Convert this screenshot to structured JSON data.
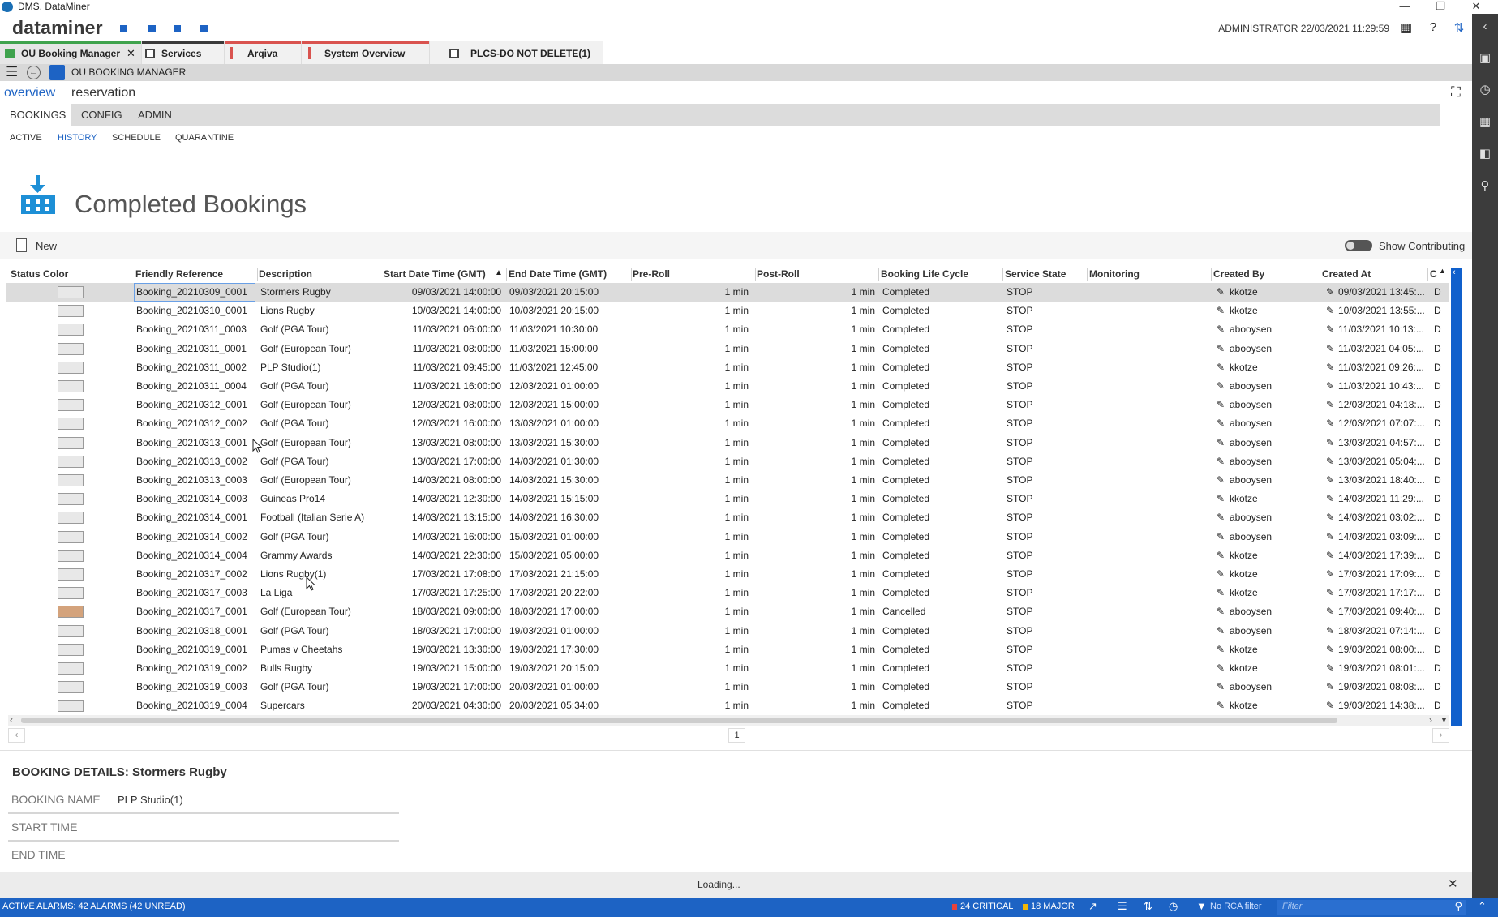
{
  "window": {
    "title": "DMS, DataMiner"
  },
  "header": {
    "brand": "dataminer",
    "user": "ADMINISTRATOR",
    "datetime": "22/03/2021 11:29:59"
  },
  "tabs": [
    {
      "label": "OU Booking Manager",
      "stripe": "#3fa34d",
      "active": true
    },
    {
      "label": "Services",
      "stripe": "#3a3a3a"
    },
    {
      "label": "Arqiva",
      "stripe": "#d9534f"
    },
    {
      "label": "System Overview",
      "stripe": "#d9534f"
    },
    {
      "label": "PLCS-DO NOT DELETE(1)",
      "stripe": ""
    }
  ],
  "pagebar": {
    "title": "OU BOOKING MANAGER"
  },
  "nav_primary": [
    "overview",
    "reservation"
  ],
  "nav_secondary": [
    "BOOKINGS",
    "CONFIG",
    "ADMIN"
  ],
  "nav_tertiary": [
    "ACTIVE",
    "HISTORY",
    "SCHEDULE",
    "QUARANTINE"
  ],
  "page": {
    "title": "Completed Bookings"
  },
  "actions": {
    "new_label": "New",
    "toggle_label": "Show Contributing"
  },
  "table": {
    "columns": [
      "Status Color",
      "Friendly Reference",
      "Description",
      "Start Date Time (GMT)",
      "End Date Time (GMT)",
      "Pre-Roll",
      "Post-Roll",
      "Booking Life Cycle",
      "Service State",
      "Monitoring",
      "Created By",
      "Created At",
      "C"
    ],
    "rows": [
      {
        "color": "#e8e8e8",
        "ref": "Booking_20210309_0001",
        "desc": "Stormers Rugby",
        "start": "09/03/2021 14:00:00",
        "end": "09/03/2021 20:15:00",
        "pre": "1 min",
        "post": "1 min",
        "life": "Completed",
        "state": "STOP",
        "by": "kkotze",
        "at": "09/03/2021 13:45:...",
        "c": "D"
      },
      {
        "color": "#e8e8e8",
        "ref": "Booking_20210310_0001",
        "desc": "Lions Rugby",
        "start": "10/03/2021 14:00:00",
        "end": "10/03/2021 20:15:00",
        "pre": "1 min",
        "post": "1 min",
        "life": "Completed",
        "state": "STOP",
        "by": "kkotze",
        "at": "10/03/2021 13:55:...",
        "c": "D"
      },
      {
        "color": "#e8e8e8",
        "ref": "Booking_20210311_0003",
        "desc": "Golf (PGA Tour)",
        "start": "11/03/2021 06:00:00",
        "end": "11/03/2021 10:30:00",
        "pre": "1 min",
        "post": "1 min",
        "life": "Completed",
        "state": "STOP",
        "by": "abooysen",
        "at": "11/03/2021 10:13:...",
        "c": "D"
      },
      {
        "color": "#e8e8e8",
        "ref": "Booking_20210311_0001",
        "desc": "Golf (European Tour)",
        "start": "11/03/2021 08:00:00",
        "end": "11/03/2021 15:00:00",
        "pre": "1 min",
        "post": "1 min",
        "life": "Completed",
        "state": "STOP",
        "by": "abooysen",
        "at": "11/03/2021 04:05:...",
        "c": "D"
      },
      {
        "color": "#e8e8e8",
        "ref": "Booking_20210311_0002",
        "desc": "PLP Studio(1)",
        "start": "11/03/2021 09:45:00",
        "end": "11/03/2021 12:45:00",
        "pre": "1 min",
        "post": "1 min",
        "life": "Completed",
        "state": "STOP",
        "by": "kkotze",
        "at": "11/03/2021 09:26:...",
        "c": "D"
      },
      {
        "color": "#e8e8e8",
        "ref": "Booking_20210311_0004",
        "desc": "Golf (PGA Tour)",
        "start": "11/03/2021 16:00:00",
        "end": "12/03/2021 01:00:00",
        "pre": "1 min",
        "post": "1 min",
        "life": "Completed",
        "state": "STOP",
        "by": "abooysen",
        "at": "11/03/2021 10:43:...",
        "c": "D"
      },
      {
        "color": "#e8e8e8",
        "ref": "Booking_20210312_0001",
        "desc": "Golf (European Tour)",
        "start": "12/03/2021 08:00:00",
        "end": "12/03/2021 15:00:00",
        "pre": "1 min",
        "post": "1 min",
        "life": "Completed",
        "state": "STOP",
        "by": "abooysen",
        "at": "12/03/2021 04:18:...",
        "c": "D"
      },
      {
        "color": "#e8e8e8",
        "ref": "Booking_20210312_0002",
        "desc": "Golf (PGA Tour)",
        "start": "12/03/2021 16:00:00",
        "end": "13/03/2021 01:00:00",
        "pre": "1 min",
        "post": "1 min",
        "life": "Completed",
        "state": "STOP",
        "by": "abooysen",
        "at": "12/03/2021 07:07:...",
        "c": "D"
      },
      {
        "color": "#e8e8e8",
        "ref": "Booking_20210313_0001",
        "desc": "Golf (European Tour)",
        "start": "13/03/2021 08:00:00",
        "end": "13/03/2021 15:30:00",
        "pre": "1 min",
        "post": "1 min",
        "life": "Completed",
        "state": "STOP",
        "by": "abooysen",
        "at": "13/03/2021 04:57:...",
        "c": "D"
      },
      {
        "color": "#e8e8e8",
        "ref": "Booking_20210313_0002",
        "desc": "Golf (PGA Tour)",
        "start": "13/03/2021 17:00:00",
        "end": "14/03/2021 01:30:00",
        "pre": "1 min",
        "post": "1 min",
        "life": "Completed",
        "state": "STOP",
        "by": "abooysen",
        "at": "13/03/2021 05:04:...",
        "c": "D"
      },
      {
        "color": "#e8e8e8",
        "ref": "Booking_20210313_0003",
        "desc": "Golf (European Tour)",
        "start": "14/03/2021 08:00:00",
        "end": "14/03/2021 15:30:00",
        "pre": "1 min",
        "post": "1 min",
        "life": "Completed",
        "state": "STOP",
        "by": "abooysen",
        "at": "13/03/2021 18:40:...",
        "c": "D"
      },
      {
        "color": "#e8e8e8",
        "ref": "Booking_20210314_0003",
        "desc": "Guineas Pro14",
        "start": "14/03/2021 12:30:00",
        "end": "14/03/2021 15:15:00",
        "pre": "1 min",
        "post": "1 min",
        "life": "Completed",
        "state": "STOP",
        "by": "kkotze",
        "at": "14/03/2021 11:29:...",
        "c": "D"
      },
      {
        "color": "#e8e8e8",
        "ref": "Booking_20210314_0001",
        "desc": "Football (Italian Serie A)",
        "start": "14/03/2021 13:15:00",
        "end": "14/03/2021 16:30:00",
        "pre": "1 min",
        "post": "1 min",
        "life": "Completed",
        "state": "STOP",
        "by": "abooysen",
        "at": "14/03/2021 03:02:...",
        "c": "D"
      },
      {
        "color": "#e8e8e8",
        "ref": "Booking_20210314_0002",
        "desc": "Golf (PGA Tour)",
        "start": "14/03/2021 16:00:00",
        "end": "15/03/2021 01:00:00",
        "pre": "1 min",
        "post": "1 min",
        "life": "Completed",
        "state": "STOP",
        "by": "abooysen",
        "at": "14/03/2021 03:09:...",
        "c": "D"
      },
      {
        "color": "#e8e8e8",
        "ref": "Booking_20210314_0004",
        "desc": "Grammy Awards",
        "start": "14/03/2021 22:30:00",
        "end": "15/03/2021 05:00:00",
        "pre": "1 min",
        "post": "1 min",
        "life": "Completed",
        "state": "STOP",
        "by": "kkotze",
        "at": "14/03/2021 17:39:...",
        "c": "D"
      },
      {
        "color": "#e8e8e8",
        "ref": "Booking_20210317_0002",
        "desc": "Lions Rugby(1)",
        "start": "17/03/2021 17:08:00",
        "end": "17/03/2021 21:15:00",
        "pre": "1 min",
        "post": "1 min",
        "life": "Completed",
        "state": "STOP",
        "by": "kkotze",
        "at": "17/03/2021 17:09:...",
        "c": "D"
      },
      {
        "color": "#e8e8e8",
        "ref": "Booking_20210317_0003",
        "desc": "La Liga",
        "start": "17/03/2021 17:25:00",
        "end": "17/03/2021 20:22:00",
        "pre": "1 min",
        "post": "1 min",
        "life": "Completed",
        "state": "STOP",
        "by": "kkotze",
        "at": "17/03/2021 17:17:...",
        "c": "D"
      },
      {
        "color": "#d4a37c",
        "ref": "Booking_20210317_0001",
        "desc": "Golf (European Tour)",
        "start": "18/03/2021 09:00:00",
        "end": "18/03/2021 17:00:00",
        "pre": "1 min",
        "post": "1 min",
        "life": "Cancelled",
        "state": "STOP",
        "by": "abooysen",
        "at": "17/03/2021 09:40:...",
        "c": "D"
      },
      {
        "color": "#e8e8e8",
        "ref": "Booking_20210318_0001",
        "desc": "Golf (PGA Tour)",
        "start": "18/03/2021 17:00:00",
        "end": "19/03/2021 01:00:00",
        "pre": "1 min",
        "post": "1 min",
        "life": "Completed",
        "state": "STOP",
        "by": "abooysen",
        "at": "18/03/2021 07:14:...",
        "c": "D"
      },
      {
        "color": "#e8e8e8",
        "ref": "Booking_20210319_0001",
        "desc": "Pumas v Cheetahs",
        "start": "19/03/2021 13:30:00",
        "end": "19/03/2021 17:30:00",
        "pre": "1 min",
        "post": "1 min",
        "life": "Completed",
        "state": "STOP",
        "by": "kkotze",
        "at": "19/03/2021 08:00:...",
        "c": "D"
      },
      {
        "color": "#e8e8e8",
        "ref": "Booking_20210319_0002",
        "desc": "Bulls Rugby",
        "start": "19/03/2021 15:00:00",
        "end": "19/03/2021 20:15:00",
        "pre": "1 min",
        "post": "1 min",
        "life": "Completed",
        "state": "STOP",
        "by": "kkotze",
        "at": "19/03/2021 08:01:...",
        "c": "D"
      },
      {
        "color": "#e8e8e8",
        "ref": "Booking_20210319_0003",
        "desc": "Golf (PGA Tour)",
        "start": "19/03/2021 17:00:00",
        "end": "20/03/2021 01:00:00",
        "pre": "1 min",
        "post": "1 min",
        "life": "Completed",
        "state": "STOP",
        "by": "abooysen",
        "at": "19/03/2021 08:08:...",
        "c": "D"
      },
      {
        "color": "#e8e8e8",
        "ref": "Booking_20210319_0004",
        "desc": "Supercars",
        "start": "20/03/2021 04:30:00",
        "end": "20/03/2021 05:34:00",
        "pre": "1 min",
        "post": "1 min",
        "life": "Completed",
        "state": "STOP",
        "by": "kkotze",
        "at": "19/03/2021 14:38:...",
        "c": "D"
      }
    ]
  },
  "pager": {
    "page": "1"
  },
  "details": {
    "heading": "BOOKING DETAILS: Stormers Rugby",
    "fields": [
      {
        "label": "BOOKING NAME",
        "value": "PLP Studio(1)"
      },
      {
        "label": "START TIME",
        "value": ""
      },
      {
        "label": "END TIME",
        "value": ""
      }
    ]
  },
  "loading": {
    "text": "Loading..."
  },
  "statusbar": {
    "alarms": "ACTIVE ALARMS: 42 ALARMS (42 UNREAD)",
    "critical": "24 CRITICAL",
    "major": "18 MAJOR",
    "rca": "No RCA filter",
    "filter_placeholder": "Filter",
    "critical_color": "#e8423b",
    "major_color": "#f2b705"
  },
  "colors": {
    "accent": "#1d63c4",
    "selected_row": "#dcdcdc",
    "sidebar": "#3c3c3c"
  }
}
